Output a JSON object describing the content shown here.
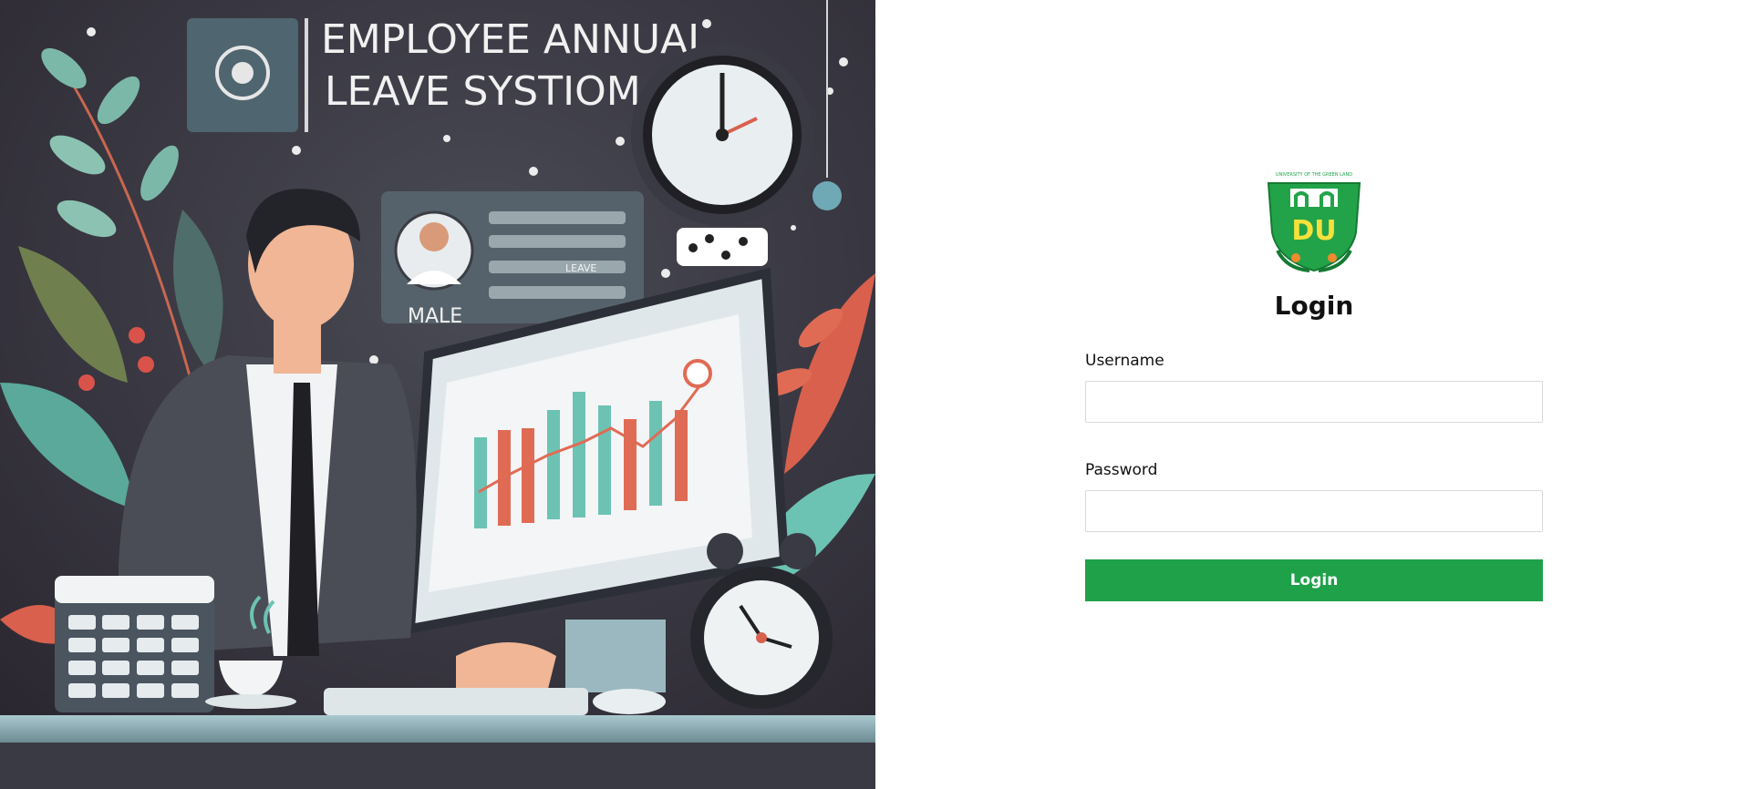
{
  "hero": {
    "title_line1": "EMPLOYEE ANNUAL",
    "title_line2": "LEAVE SYSTIOM",
    "profile_card_label": "MALE",
    "profile_card_caption": "LEAVE"
  },
  "logo": {
    "arc_text": "UNIVERSITY OF THE GREEN LAND",
    "monogram": "DU"
  },
  "login": {
    "title": "Login",
    "username_label": "Username",
    "username_value": "",
    "password_label": "Password",
    "password_value": "",
    "submit_label": "Login"
  },
  "colors": {
    "accent": "#1fa14a",
    "hero_bg": "#2b2a33",
    "teal": "#6cc3b3",
    "coral": "#e06b55"
  }
}
